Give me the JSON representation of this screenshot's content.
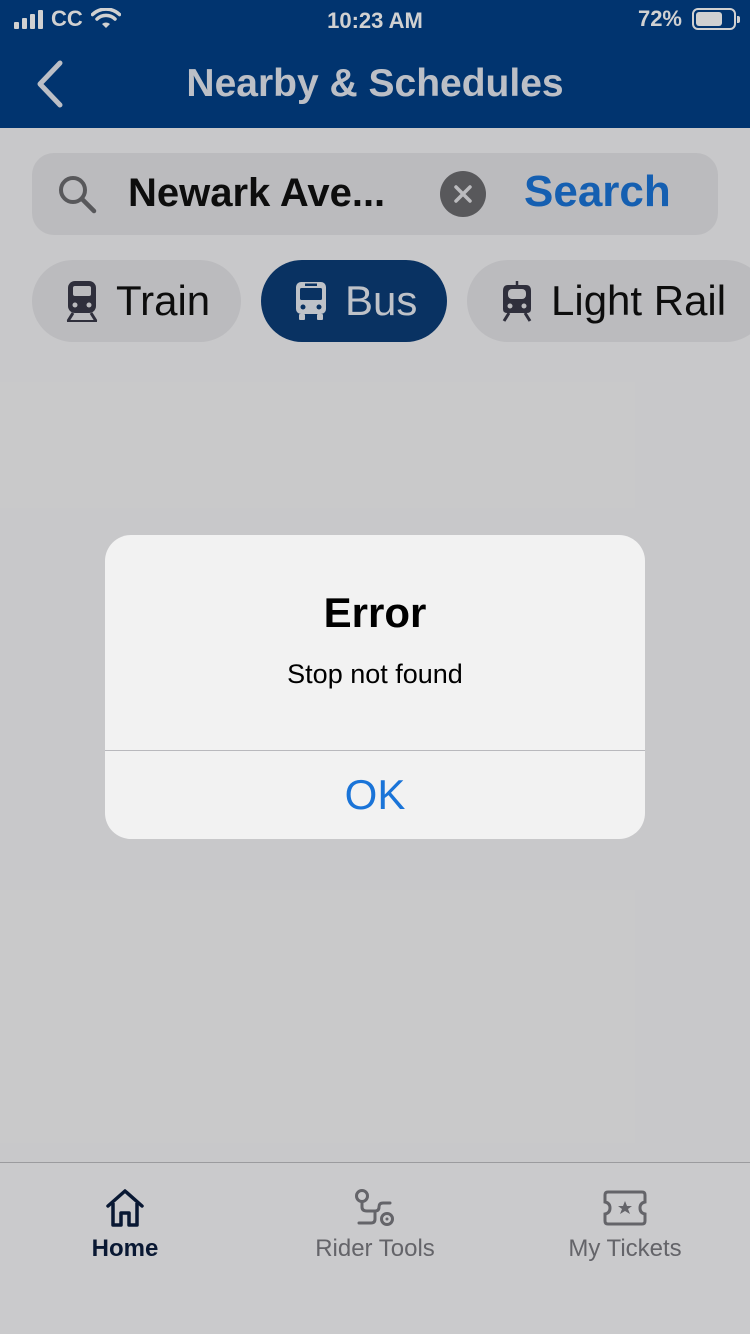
{
  "status_bar": {
    "carrier": "CC",
    "time": "10:23 AM",
    "battery_percent": "72%",
    "battery_level": 0.72,
    "signal_icon": "signal-bars-icon",
    "wifi_icon": "wifi-icon"
  },
  "nav": {
    "title": "Nearby & Schedules",
    "back_icon": "chevron-left-icon"
  },
  "search": {
    "value": "Newark Ave...",
    "button_label": "Search",
    "search_icon": "magnifier-icon",
    "clear_icon": "clear-x-icon"
  },
  "modes": [
    {
      "label": "Train",
      "icon": "train-icon",
      "selected": false
    },
    {
      "label": "Bus",
      "icon": "bus-icon",
      "selected": true
    },
    {
      "label": "Light Rail",
      "icon": "light-rail-icon",
      "selected": false
    }
  ],
  "alert": {
    "title": "Error",
    "message": "Stop not found",
    "ok_label": "OK"
  },
  "tabs": [
    {
      "label": "Home",
      "icon": "home-icon",
      "active": true
    },
    {
      "label": "Rider Tools",
      "icon": "route-icon",
      "active": false
    },
    {
      "label": "My Tickets",
      "icon": "ticket-icon",
      "active": false
    }
  ],
  "colors": {
    "header_bg": "#024088",
    "accent": "#1a74d8",
    "chip_selected_bg": "#0c3d78"
  }
}
